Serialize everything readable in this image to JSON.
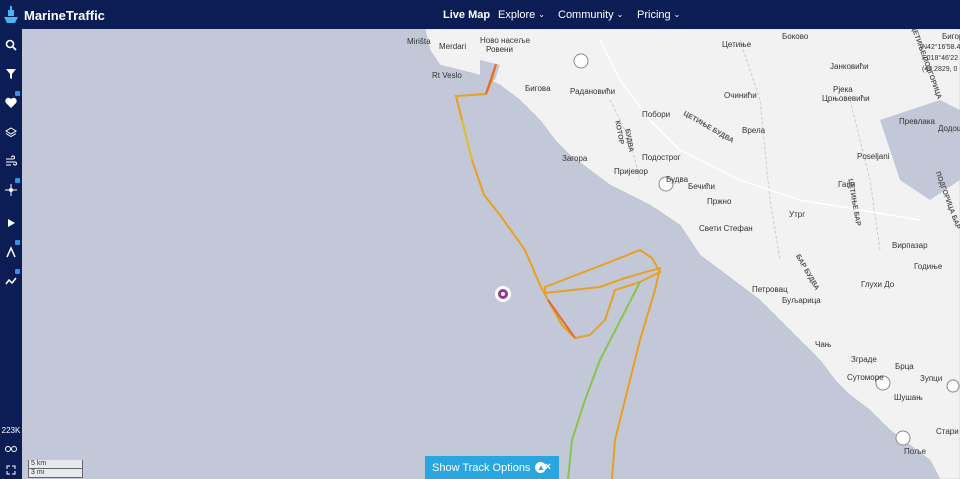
{
  "brand": {
    "name": "MarineTraffic"
  },
  "nav": {
    "live_map": "Live Map",
    "explore": "Explore",
    "community": "Community",
    "pricing": "Pricing"
  },
  "sidebar": {
    "items": [
      "search-icon",
      "filter-icon",
      "heart-icon",
      "layers-icon",
      "wind-icon",
      "vessel-icon",
      "play-icon",
      "route-icon",
      "analytics-icon"
    ],
    "vessel_count": "223K"
  },
  "map": {
    "labels": [
      "Mirišta",
      "Merdari",
      "Ново насеље",
      "Ровени",
      "Rt Veslo",
      "Бигова",
      "Радановићи",
      "Цетиње",
      "Боково",
      "Бигор",
      "Јанковићи",
      "Очинићи",
      "Црњовевићи",
      "Рјека",
      "Превлака",
      "Додош",
      "Побори",
      "Врела",
      "Загора",
      "Подострог",
      "Пријевор",
      "Будва",
      "Бечићи",
      "Пржно",
      "Poseljani",
      "Гаџи",
      "Утрг",
      "Свети Стефан",
      "Вирпазар",
      "Годиње",
      "Петровац",
      "Буљарица",
      "Глухи До",
      "Сутоморе",
      "Брца",
      "Зупци",
      "Шушањ",
      "Стари",
      "Пољe",
      "Зграде",
      "Чањ"
    ],
    "region_labels": [
      "КОТОР",
      "БУДВА",
      "ЦЕТИЊЕ БУДВА",
      "ЦЕТИЊЕ БАР",
      "ПОДГОРИЦА БАР",
      "БАР БУДВА",
      "ЦЕТИЊЕ ПОДГОРИЦА"
    ],
    "coords": [
      "N42°16'58.4",
      "E018°46'22",
      "(42.2829, 0"
    ],
    "scale": [
      "5 km",
      "3 mi"
    ]
  },
  "track_options": {
    "label": "Show Track Options",
    "close": "×"
  },
  "colors": {
    "navy": "#0c1d56",
    "sea": "#c3c8d8",
    "land": "#f2f2f2",
    "accent": "#29a6e0"
  }
}
